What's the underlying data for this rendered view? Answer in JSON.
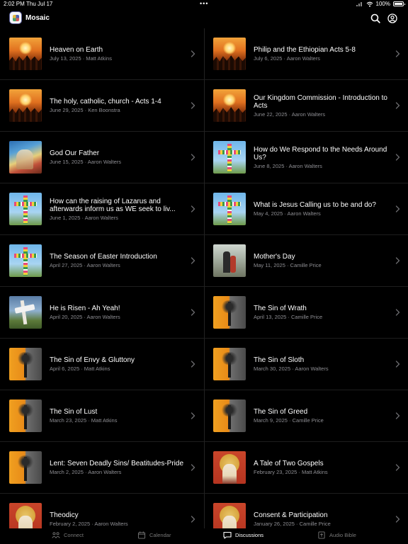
{
  "status_bar": {
    "time": "2:02 PM",
    "date": "Thu Jul 17",
    "dots": "•••",
    "battery": "100%"
  },
  "header": {
    "app_name": "Mosaic",
    "actions": [
      "search-icon",
      "account-icon"
    ]
  },
  "discussions": {
    "left": [
      {
        "title": "Heaven on Earth",
        "meta": "July 13, 2025 · Matt Atkins",
        "thumb": "worship"
      },
      {
        "title": "The holy, catholic, church - Acts 1-4",
        "meta": "June 29, 2025 · Ken Boonstra",
        "thumb": "worship"
      },
      {
        "title": "God Our Father",
        "meta": "June 15, 2025 · Aaron Walters",
        "thumb": "father"
      },
      {
        "title": "How can the raising of Lazarus and afterwards inform us as WE seek to liv...",
        "meta": "June 1, 2025 · Aaron Walters",
        "thumb": "cross"
      },
      {
        "title": "The Season of Easter Introduction",
        "meta": "April 27, 2025 · Aaron Walters",
        "thumb": "cross"
      },
      {
        "title": "He is Risen - Ah Yeah!",
        "meta": "April 20, 2025 · Aaron Walters",
        "thumb": "risen"
      },
      {
        "title": "The Sin of Envy & Gluttony",
        "meta": "April 6, 2025 · Matt Atkins",
        "thumb": "sin"
      },
      {
        "title": "The Sin of Lust",
        "meta": "March 23, 2025 · Matt Atkins",
        "thumb": "sin"
      },
      {
        "title": "Lent: Seven Deadly Sins/ Beatitudes-Pride",
        "meta": "March 2, 2025 · Aaron Walters",
        "thumb": "sin"
      },
      {
        "title": "Theodicy",
        "meta": "February 2, 2025 · Aaron Walters",
        "thumb": "icon"
      }
    ],
    "right": [
      {
        "title": "Philip and the Ethiopian Acts 5-8",
        "meta": "July 6, 2025 · Aaron Walters",
        "thumb": "worship"
      },
      {
        "title": "Our Kingdom Commission - Introduction to Acts",
        "meta": "June 22, 2025 · Aaron Walters",
        "thumb": "worship"
      },
      {
        "title": "How do We Respond to the Needs Around Us?",
        "meta": "June 8, 2025 · Aaron Walters",
        "thumb": "cross"
      },
      {
        "title": "What is Jesus Calling us to be and do?",
        "meta": "May 4, 2025 · Aaron Walters",
        "thumb": "cross"
      },
      {
        "title": "Mother's Day",
        "meta": "May 11, 2025 · Camille Price",
        "thumb": "walk"
      },
      {
        "title": "The Sin of Wrath",
        "meta": "April 13, 2025 · Camille Price",
        "thumb": "sin"
      },
      {
        "title": "The Sin of Sloth",
        "meta": "March 30, 2025 · Aaron Walters",
        "thumb": "sin"
      },
      {
        "title": "The Sin of Greed",
        "meta": "March 9, 2025 · Camille Price",
        "thumb": "sin"
      },
      {
        "title": "A Tale of Two Gospels",
        "meta": "February 23, 2025 · Matt Atkins",
        "thumb": "icon"
      },
      {
        "title": "Consent & Participation",
        "meta": "January 26, 2025 · Camille Price",
        "thumb": "icon"
      }
    ]
  },
  "tabbar": {
    "tabs": [
      {
        "label": "Connect",
        "icon": "people-icon",
        "active": false
      },
      {
        "label": "Calendar",
        "icon": "calendar-icon",
        "active": false
      },
      {
        "label": "Discussions",
        "icon": "chat-icon",
        "active": true
      },
      {
        "label": "Audio Bible",
        "icon": "bible-icon",
        "active": false
      }
    ]
  }
}
